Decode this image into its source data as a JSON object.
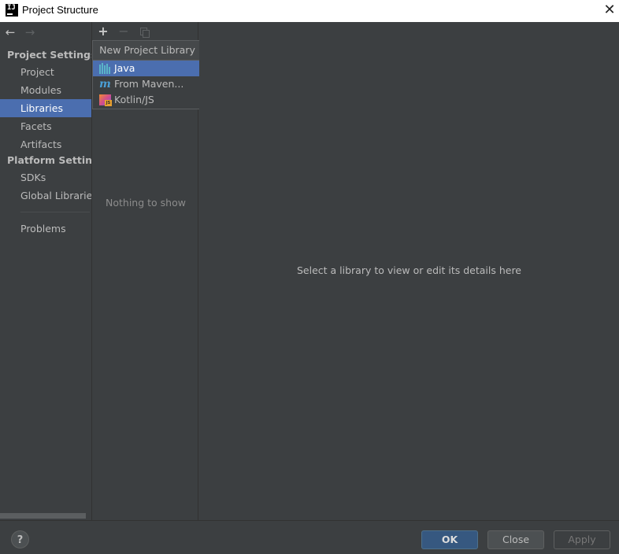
{
  "window": {
    "title": "Project Structure",
    "logo_text": "IJ",
    "close_glyph": "✕"
  },
  "nav": {
    "back_glyph": "←",
    "forward_glyph": "→"
  },
  "sidebar": {
    "project_settings_header": "Project Settings",
    "platform_settings_header": "Platform Settings",
    "items": [
      {
        "label": "Project"
      },
      {
        "label": "Modules"
      },
      {
        "label": "Libraries",
        "selected": true
      },
      {
        "label": "Facets"
      },
      {
        "label": "Artifacts"
      },
      {
        "label": "SDKs"
      },
      {
        "label": "Global Libraries"
      },
      {
        "label": "Problems"
      }
    ]
  },
  "middle_pane": {
    "toolbar": {
      "add_glyph": "+",
      "remove_glyph": "−"
    },
    "empty_text": "Nothing to show"
  },
  "popup": {
    "title": "New Project Library",
    "items": [
      {
        "label": "Java",
        "icon": "java-library-icon",
        "selected": true
      },
      {
        "label": "From Maven...",
        "icon": "maven-icon"
      },
      {
        "label": "Kotlin/JS",
        "icon": "kotlin-js-icon"
      }
    ],
    "maven_icon_glyph": "m",
    "kotlin_badge": "JS"
  },
  "detail": {
    "placeholder": "Select a library to view or edit its details here"
  },
  "footer": {
    "help_glyph": "?",
    "ok_label": "OK",
    "close_label": "Close",
    "apply_label": "Apply"
  },
  "colors": {
    "selection": "#4b6eaf",
    "panel_bg": "#3c3f41",
    "ok_button": "#365880"
  }
}
